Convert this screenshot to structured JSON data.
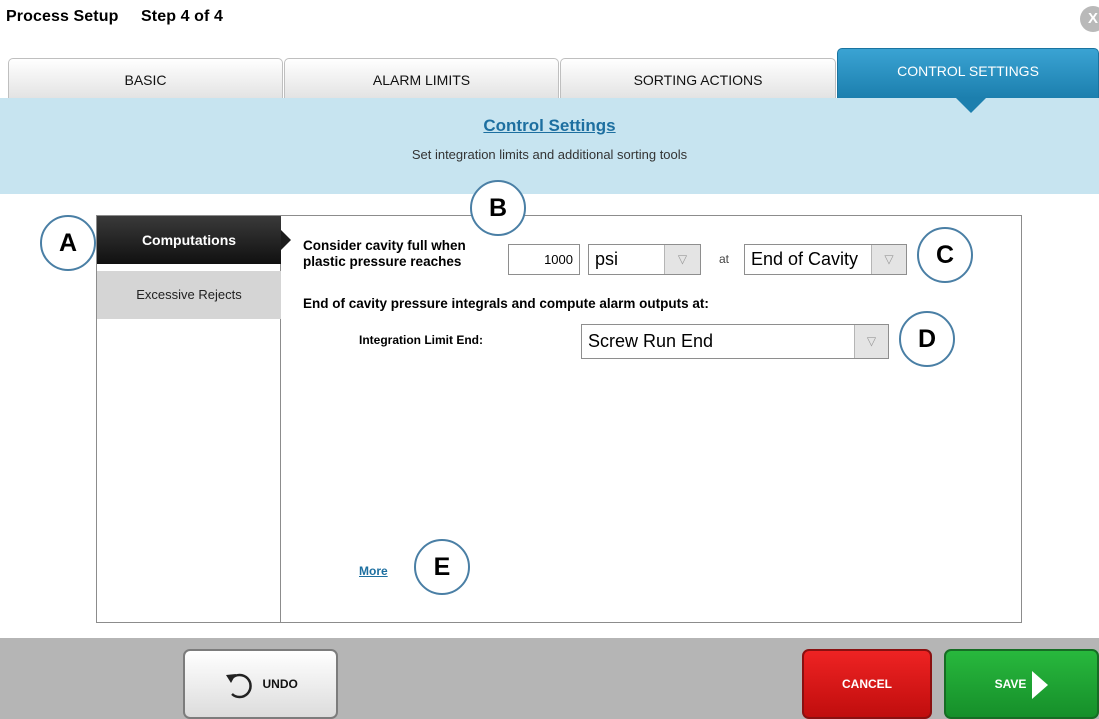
{
  "header": {
    "title": "Process Setup",
    "step": "Step 4 of 4",
    "close_label": "X"
  },
  "tabs": [
    {
      "label": "BASIC"
    },
    {
      "label": "ALARM LIMITS"
    },
    {
      "label": "SORTING ACTIONS"
    },
    {
      "label": "CONTROL SETTINGS",
      "active": true
    }
  ],
  "banner": {
    "title": "Control Settings",
    "subtitle": "Set integration limits and additional sorting tools"
  },
  "sidebar": {
    "items": [
      {
        "label": "Computations",
        "active": true
      },
      {
        "label": "Excessive Rejects"
      }
    ]
  },
  "form": {
    "cavity_full_label_line1": "Consider cavity full when",
    "cavity_full_label_line2": "plastic pressure reaches",
    "pressure_value": "1000",
    "unit_value": "psi",
    "at_label": "at",
    "location_value": "End of Cavity",
    "integrals_label": "End of cavity pressure integrals and compute alarm outputs at:",
    "integration_limit_label": "Integration Limit End:",
    "integration_limit_value": "Screw Run End",
    "more_link": "More"
  },
  "callouts": [
    "A",
    "B",
    "C",
    "D",
    "E"
  ],
  "footer": {
    "undo_label": "UNDO",
    "cancel_label": "CANCEL",
    "save_label": "SAVE"
  },
  "colors": {
    "accent_blue": "#1c7fae",
    "banner_bg": "#c7e4f0",
    "cancel_red": "#d81818",
    "save_green": "#1fa334"
  }
}
